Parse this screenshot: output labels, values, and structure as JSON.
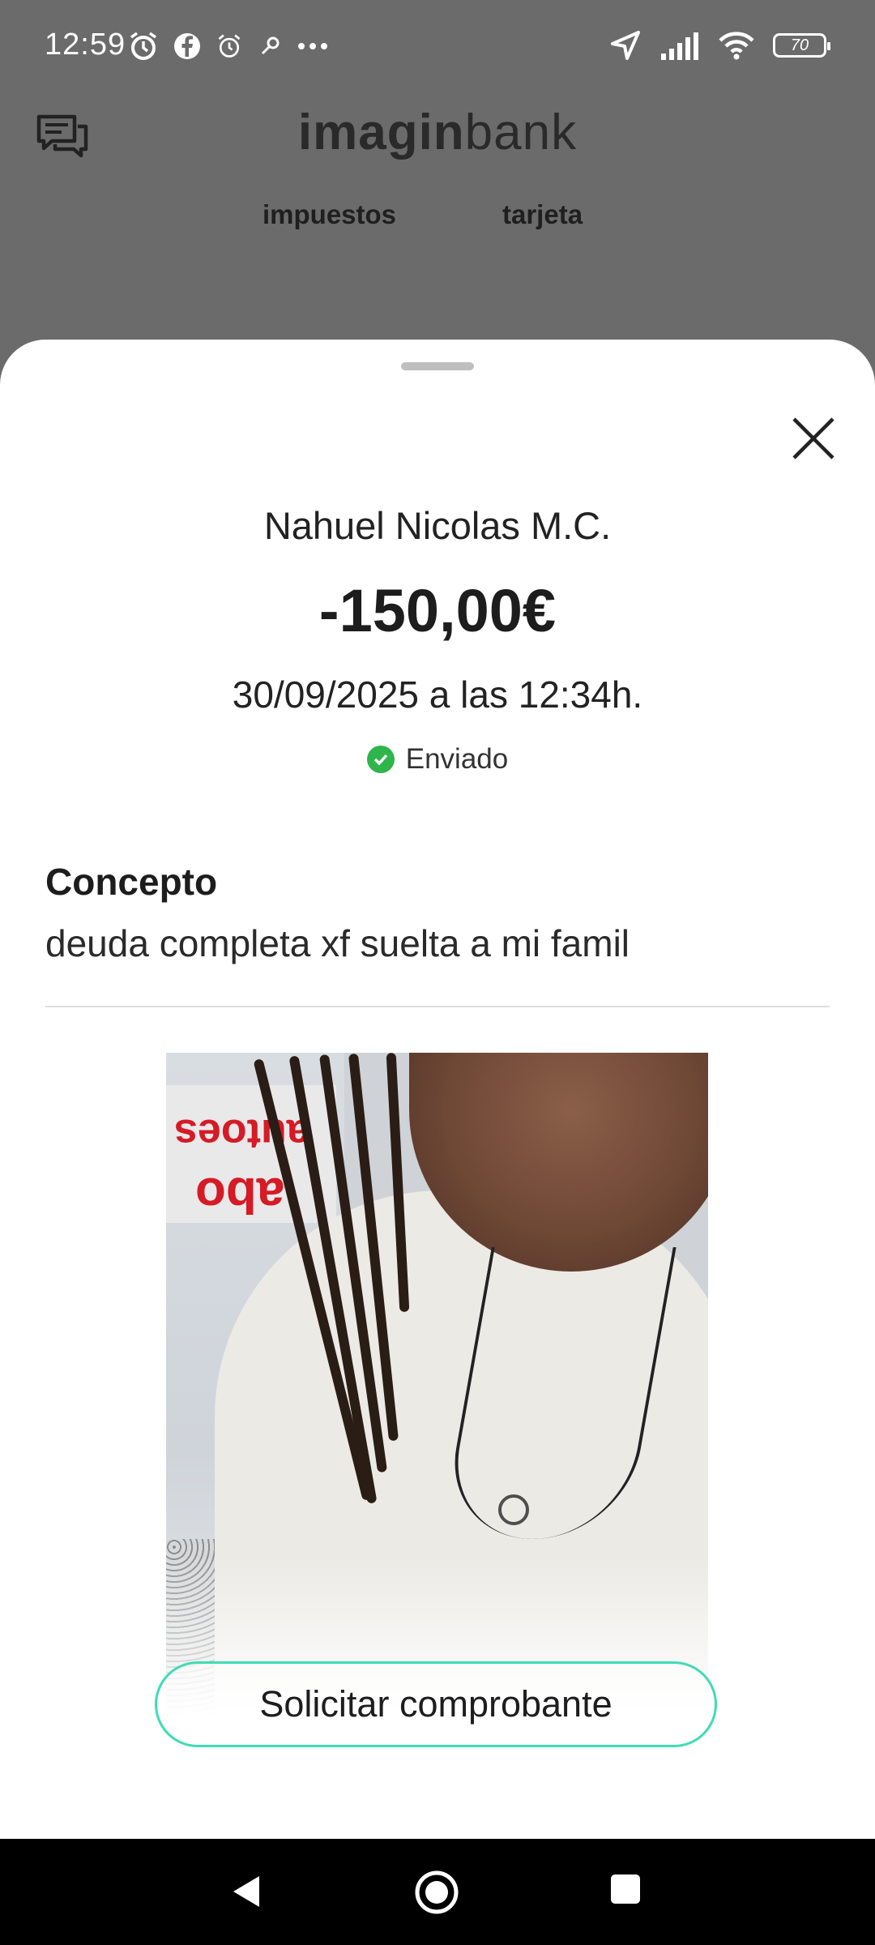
{
  "status_bar": {
    "time": "12:59",
    "battery": "70",
    "left_icons": [
      "alarm-icon",
      "facebook-icon",
      "alarm-icon",
      "key-icon",
      "more-dots-icon"
    ],
    "right_icons": [
      "location-icon",
      "signal-icon",
      "wifi-icon",
      "battery-icon"
    ]
  },
  "app_header": {
    "brand_bold": "imagin",
    "brand_light": "bank",
    "tabs": [
      "impuestos",
      "tarjeta"
    ]
  },
  "detail": {
    "payee": "Nahuel Nicolas M.C.",
    "amount": "-150,00€",
    "datetime": "30/09/2025 a las 12:34h.",
    "status": "Enviado",
    "concept_label": "Concepto",
    "concept_value": "deuda completa xf suelta a mi famil",
    "button_label": "Solicitar comprobante"
  },
  "photo_sign": {
    "top": "autoes",
    "bottom": "abo"
  },
  "colors": {
    "overlay": "#6b6b6b",
    "status_green": "#2fb54a",
    "button_border": "#3fdcb4"
  }
}
